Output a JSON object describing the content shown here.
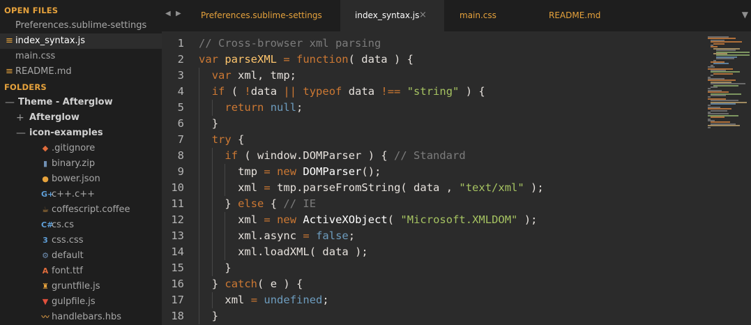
{
  "sidebar": {
    "open_files_header": "OPEN FILES",
    "open_files": [
      {
        "name": "Preferences.sublime-settings",
        "modified": false,
        "active": false
      },
      {
        "name": "index_syntax.js",
        "modified": true,
        "active": true
      },
      {
        "name": "main.css",
        "modified": false,
        "active": false
      },
      {
        "name": "README.md",
        "modified": true,
        "active": false
      }
    ],
    "folders_header": "FOLDERS",
    "root_folder": {
      "label": "Theme - Afterglow",
      "toggle": "—"
    },
    "subfolders": [
      {
        "label": "Afterglow",
        "toggle": "+"
      },
      {
        "label": "icon-examples",
        "toggle": "—"
      }
    ],
    "files": [
      {
        "name": ".gitignore",
        "icon": "git-icon",
        "glyph": "◆",
        "color": "#e06c3c"
      },
      {
        "name": "binary.zip",
        "icon": "zip-icon",
        "glyph": "▮",
        "color": "#6f8fb3"
      },
      {
        "name": "bower.json",
        "icon": "bower-icon",
        "glyph": "●",
        "color": "#e6a23c"
      },
      {
        "name": "c++.c++",
        "icon": "cpp-icon",
        "glyph": "G+",
        "color": "#5f9fd8"
      },
      {
        "name": "coffescript.coffee",
        "icon": "coffee-icon",
        "glyph": "☕",
        "color": "#c0883f"
      },
      {
        "name": "cs.cs",
        "icon": "csharp-icon",
        "glyph": "C#",
        "color": "#5f9fd8"
      },
      {
        "name": "css.css",
        "icon": "css-icon",
        "glyph": "3",
        "color": "#5f9fd8"
      },
      {
        "name": "default",
        "icon": "gear-icon",
        "glyph": "⚙",
        "color": "#6f8fb3"
      },
      {
        "name": "font.ttf",
        "icon": "font-icon",
        "glyph": "A",
        "color": "#e06c3c"
      },
      {
        "name": "gruntfile.js",
        "icon": "grunt-icon",
        "glyph": "♜",
        "color": "#e6a23c"
      },
      {
        "name": "gulpfile.js",
        "icon": "gulp-icon",
        "glyph": "▼",
        "color": "#e0503c"
      },
      {
        "name": "handlebars.hbs",
        "icon": "handlebars-icon",
        "glyph": "〰",
        "color": "#c0883f"
      }
    ]
  },
  "tabbar": {
    "back_arrow": "◀",
    "forward_arrow": "▶",
    "tabs": [
      {
        "label": "Preferences.sublime-settings",
        "active": false
      },
      {
        "label": "index_syntax.js",
        "active": true,
        "close": "×"
      },
      {
        "label": "main.css",
        "active": false
      },
      {
        "label": "README.md",
        "active": false
      }
    ],
    "dropdown": "▼"
  },
  "editor": {
    "lines": [
      {
        "n": "1",
        "indent": 0,
        "tokens": [
          [
            "cm",
            "// Cross-browser xml parsing"
          ]
        ]
      },
      {
        "n": "2",
        "indent": 0,
        "tokens": [
          [
            "kw",
            "var "
          ],
          [
            "fn",
            "parseXML"
          ],
          [
            "kw",
            " = "
          ],
          [
            "kw",
            "function"
          ],
          [
            "",
            "( data ) {"
          ]
        ]
      },
      {
        "n": "3",
        "indent": 1,
        "tokens": [
          [
            "kw",
            "var "
          ],
          [
            "",
            "xml, tmp;"
          ]
        ]
      },
      {
        "n": "4",
        "indent": 1,
        "tokens": [
          [
            "kw",
            "if "
          ],
          [
            "",
            "( "
          ],
          [
            "kw",
            "!"
          ],
          [
            "",
            "data "
          ],
          [
            "kw",
            "|| typeof "
          ],
          [
            "",
            "data "
          ],
          [
            "kw",
            "!== "
          ],
          [
            "st",
            "\"string\""
          ],
          [
            "",
            " ) {"
          ]
        ]
      },
      {
        "n": "5",
        "indent": 2,
        "tokens": [
          [
            "kw",
            "return "
          ],
          [
            "cn",
            "null"
          ],
          [
            "",
            ";"
          ]
        ]
      },
      {
        "n": "6",
        "indent": 1,
        "tokens": [
          [
            "",
            "}"
          ]
        ]
      },
      {
        "n": "7",
        "indent": 1,
        "tokens": [
          [
            "kw",
            "try "
          ],
          [
            "",
            "{"
          ]
        ]
      },
      {
        "n": "8",
        "indent": 2,
        "tokens": [
          [
            "kw",
            "if "
          ],
          [
            "",
            "( window.DOMParser ) { "
          ],
          [
            "cm",
            "// Standard"
          ]
        ]
      },
      {
        "n": "9",
        "indent": 3,
        "tokens": [
          [
            "",
            "tmp "
          ],
          [
            "kw",
            "= new "
          ],
          [
            "cl",
            "DOMParser"
          ],
          [
            "",
            "();"
          ]
        ]
      },
      {
        "n": "10",
        "indent": 3,
        "tokens": [
          [
            "",
            "xml "
          ],
          [
            "kw",
            "= "
          ],
          [
            "",
            "tmp.parseFromString( data , "
          ],
          [
            "st",
            "\"text/xml\""
          ],
          [
            "",
            " );"
          ]
        ]
      },
      {
        "n": "11",
        "indent": 2,
        "tokens": [
          [
            "",
            "} "
          ],
          [
            "kw",
            "else "
          ],
          [
            "",
            "{ "
          ],
          [
            "cm",
            "// IE"
          ]
        ]
      },
      {
        "n": "12",
        "indent": 3,
        "tokens": [
          [
            "",
            "xml "
          ],
          [
            "kw",
            "= new "
          ],
          [
            "cl",
            "ActiveXObject"
          ],
          [
            "",
            "( "
          ],
          [
            "st",
            "\"Microsoft.XMLDOM\""
          ],
          [
            "",
            " );"
          ]
        ]
      },
      {
        "n": "13",
        "indent": 3,
        "tokens": [
          [
            "",
            "xml.async "
          ],
          [
            "kw",
            "= "
          ],
          [
            "cn",
            "false"
          ],
          [
            "",
            ";"
          ]
        ]
      },
      {
        "n": "14",
        "indent": 3,
        "tokens": [
          [
            "",
            "xml.loadXML( data );"
          ]
        ]
      },
      {
        "n": "15",
        "indent": 2,
        "tokens": [
          [
            "",
            "}"
          ]
        ]
      },
      {
        "n": "16",
        "indent": 1,
        "tokens": [
          [
            "",
            "} "
          ],
          [
            "kw",
            "catch"
          ],
          [
            "",
            "( e ) {"
          ]
        ]
      },
      {
        "n": "17",
        "indent": 2,
        "tokens": [
          [
            "",
            "xml "
          ],
          [
            "kw",
            "= "
          ],
          [
            "cn",
            "undefined"
          ],
          [
            "",
            ";"
          ]
        ]
      },
      {
        "n": "18",
        "indent": 1,
        "tokens": [
          [
            "",
            "}"
          ]
        ]
      }
    ]
  },
  "colors": {
    "accent": "#e6a23c",
    "sidebar_bg": "#1e1e1e",
    "editor_bg": "#2b2b2b"
  }
}
